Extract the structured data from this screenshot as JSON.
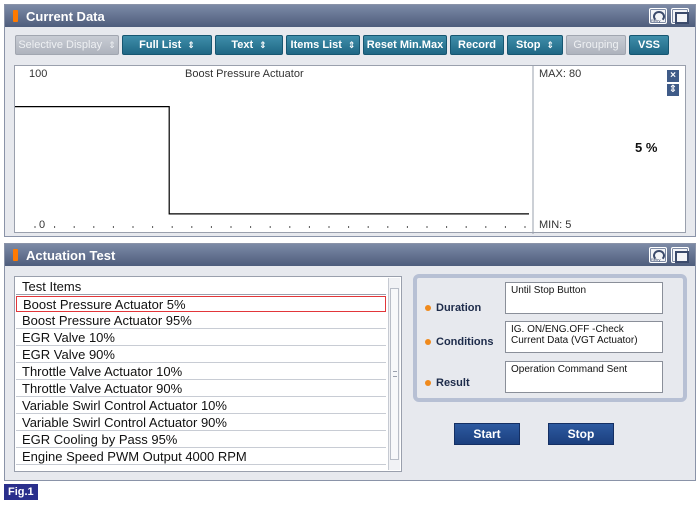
{
  "current_data": {
    "title": "Current Data",
    "toolbar": [
      {
        "label": "Selective Display",
        "chevron": true,
        "enabled": false
      },
      {
        "label": "Full List",
        "chevron": true,
        "enabled": true
      },
      {
        "label": "Text",
        "chevron": true,
        "enabled": true
      },
      {
        "label": "Items List",
        "chevron": true,
        "enabled": true
      },
      {
        "label": "Reset Min.Max",
        "chevron": false,
        "enabled": true
      },
      {
        "label": "Record",
        "chevron": false,
        "enabled": true
      },
      {
        "label": "Stop",
        "chevron": true,
        "enabled": true
      },
      {
        "label": "Grouping",
        "chevron": false,
        "enabled": false
      },
      {
        "label": "VSS",
        "chevron": false,
        "enabled": true
      }
    ],
    "graph": {
      "y_max_label": "100",
      "y_min_label": "0",
      "name": "Boost Pressure Actuator",
      "max_text": "MAX: 80",
      "min_text": "MIN: 5",
      "current_value": "5 %",
      "line_color": "#000000"
    }
  },
  "chart_data": {
    "type": "line",
    "title": "Boost Pressure Actuator",
    "ylim": [
      0,
      100
    ],
    "series": [
      {
        "values": [
          80,
          80,
          80,
          80,
          80,
          80,
          80,
          80,
          80,
          80,
          80,
          80,
          80,
          80,
          80,
          80,
          80,
          80,
          80,
          80,
          80,
          80,
          80,
          80,
          80,
          80,
          80,
          5,
          5,
          5,
          5,
          5,
          5,
          5,
          5,
          5,
          5,
          5,
          5,
          5,
          5,
          5,
          5,
          5,
          5,
          5,
          5,
          5,
          5,
          5,
          5,
          5,
          5,
          5,
          5,
          5,
          5,
          5,
          5,
          5,
          5,
          5,
          5,
          5,
          5,
          5,
          5,
          5,
          5,
          5,
          5,
          5,
          5,
          5,
          5,
          5,
          5,
          5,
          5,
          5,
          5,
          5,
          5,
          5,
          5,
          5,
          5,
          5,
          5,
          5,
          5
        ]
      }
    ],
    "max": 80,
    "min": 5,
    "current": 5
  },
  "actuation_test": {
    "title": "Actuation Test",
    "list_header": "Test Items",
    "items": [
      "Boost Pressure Actuator 5%",
      "Boost Pressure Actuator 95%",
      "EGR Valve 10%",
      "EGR Valve 90%",
      "Throttle Valve Actuator 10%",
      "Throttle Valve Actuator 90%",
      "Variable Swirl Control Actuator 10%",
      "Variable Swirl Control Actuator 90%",
      "EGR Cooling by Pass 95%",
      "Engine Speed PWM Output 4000 RPM"
    ],
    "selected_index": 0,
    "duration_label": "Duration",
    "duration_value": "Until Stop Button",
    "conditions_label": "Conditions",
    "conditions_value": "IG. ON/ENG.OFF -Check Current Data (VGT Actuator)",
    "result_label": "Result",
    "result_value": "Operation Command Sent",
    "start_label": "Start",
    "stop_label": "Stop"
  },
  "figure_label": "Fig.1",
  "colors": {
    "accent": "#1f6785",
    "selection_border": "#e2363a",
    "bullet": "#f08a1c",
    "action_button": "#1b3f7e"
  }
}
